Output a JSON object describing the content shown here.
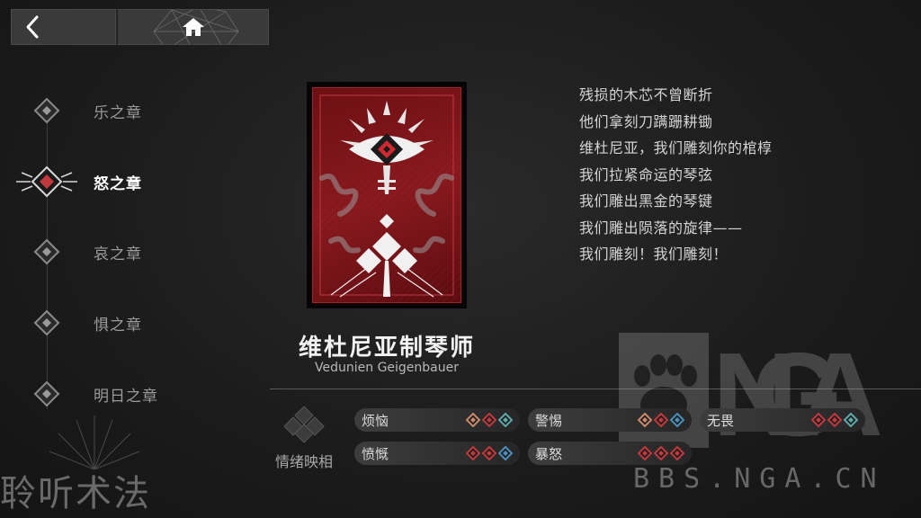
{
  "nav": {
    "back_icon": "chevron-left-icon",
    "home_icon": "home-icon",
    "chapters": [
      {
        "label": "乐之章",
        "active": false
      },
      {
        "label": "怒之章",
        "active": true
      },
      {
        "label": "哀之章",
        "active": false
      },
      {
        "label": "惧之章",
        "active": false
      },
      {
        "label": "明日之章",
        "active": false
      }
    ]
  },
  "mode_title": "聆听术法",
  "character": {
    "name": "维杜尼亚制琴师",
    "name_en": "Vedunien Geigenbauer"
  },
  "poem": [
    "残损的木芯不曾断折",
    "他们拿刻刀蹒跚耕锄",
    "维杜尼亚，我们雕刻你的棺椁",
    "我们拉紧命运的琴弦",
    "我们雕出黑金的琴键",
    "我们雕出陨落的旋律——",
    "我们雕刻！我们雕刻！"
  ],
  "emotions": {
    "label": "情绪映相",
    "items": [
      {
        "name": "烦恼",
        "diamonds": [
          "#c98a6a",
          "#c0393f",
          "#5fa9a8"
        ]
      },
      {
        "name": "警惕",
        "diamonds": [
          "#c98a6a",
          "#c0393f",
          "#4b8fb8"
        ]
      },
      {
        "name": "无畏",
        "diamonds": [
          "#c0393f",
          "#c0393f",
          "#5fa9a8"
        ]
      },
      {
        "name": "愤慨",
        "diamonds": [
          "#c0393f",
          "#c0393f",
          "#4b8fb8"
        ]
      },
      {
        "name": "暴怒",
        "diamonds": [
          "#c0393f",
          "#c0393f",
          "#c0393f"
        ]
      }
    ]
  },
  "watermark": {
    "logo": "NGA",
    "url": "BBS.NGA.CN"
  },
  "colors": {
    "accent_red": "#c0393f",
    "card_red": "#8a1a1f"
  }
}
